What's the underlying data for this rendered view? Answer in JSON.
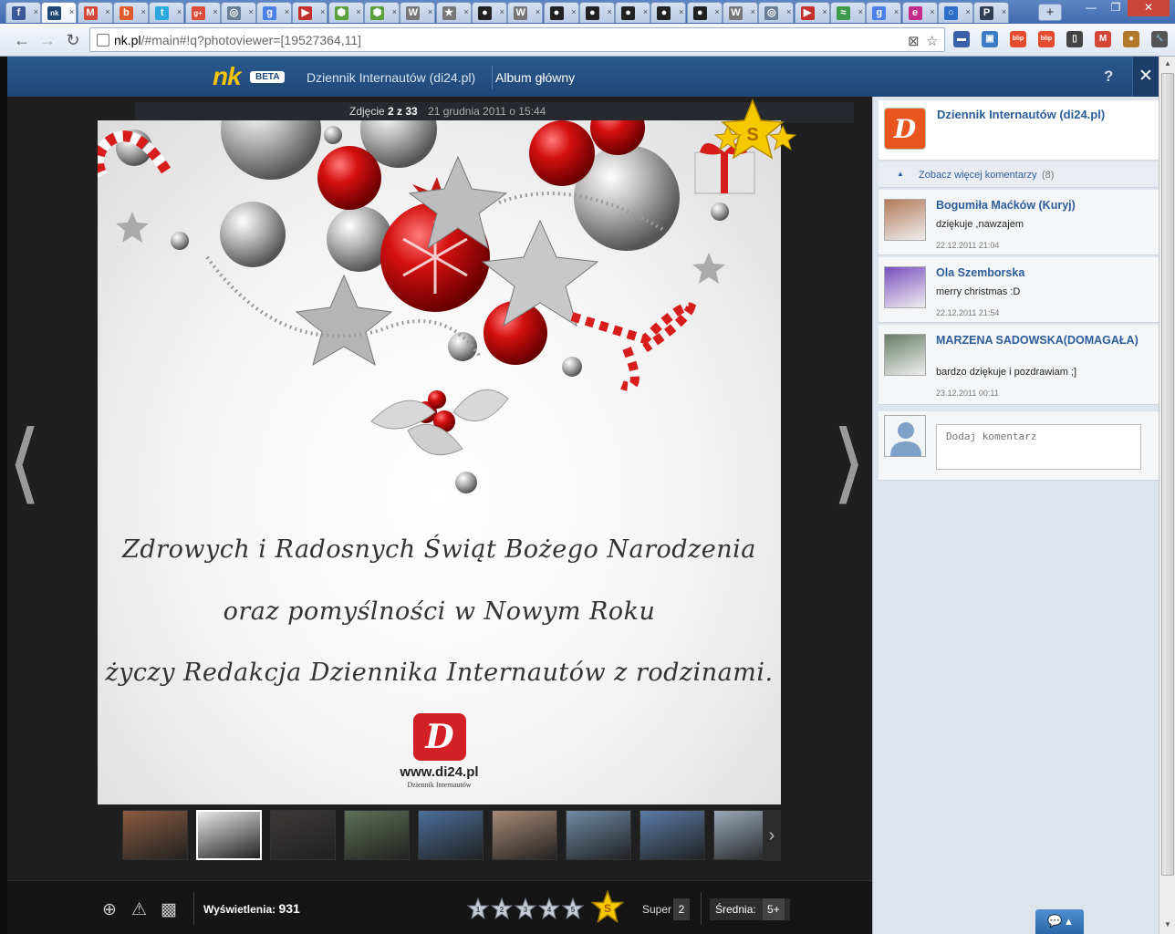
{
  "browser": {
    "tabs": [
      {
        "icon": "facebook-icon",
        "color": "#3b5998",
        "glyph": "f"
      },
      {
        "icon": "nk-icon",
        "color": "#1e4776",
        "glyph": "nk",
        "active": true
      },
      {
        "icon": "gmail-icon",
        "color": "#d44638",
        "glyph": "M"
      },
      {
        "icon": "blog-icon",
        "color": "#e05b2b",
        "glyph": "b"
      },
      {
        "icon": "twitter-icon",
        "color": "#2aa9e0",
        "glyph": "t"
      },
      {
        "icon": "google-plus-icon",
        "color": "#dd4b39",
        "glyph": "g+"
      },
      {
        "icon": "globe-icon",
        "color": "#6a7f99",
        "glyph": "◎"
      },
      {
        "icon": "google-icon",
        "color": "#4a80e8",
        "glyph": "g"
      },
      {
        "icon": "youtube-icon",
        "color": "#c4302b",
        "glyph": "▶"
      },
      {
        "icon": "hexagon-icon",
        "color": "#5aa03c",
        "glyph": "⬢"
      },
      {
        "icon": "hexagon-icon",
        "color": "#5aa03c",
        "glyph": "⬢"
      },
      {
        "icon": "wikipedia-icon",
        "color": "#777777",
        "glyph": "W"
      },
      {
        "icon": "star-icon",
        "color": "#777777",
        "glyph": "★"
      },
      {
        "icon": "github-icon",
        "color": "#222222",
        "glyph": "●"
      },
      {
        "icon": "wikipedia-icon",
        "color": "#777777",
        "glyph": "W"
      },
      {
        "icon": "github-icon",
        "color": "#222222",
        "glyph": "●"
      },
      {
        "icon": "github-icon",
        "color": "#222222",
        "glyph": "●"
      },
      {
        "icon": "github-icon",
        "color": "#222222",
        "glyph": "●"
      },
      {
        "icon": "github-icon",
        "color": "#222222",
        "glyph": "●"
      },
      {
        "icon": "github-icon",
        "color": "#222222",
        "glyph": "●"
      },
      {
        "icon": "wikipedia-icon",
        "color": "#777777",
        "glyph": "W"
      },
      {
        "icon": "globe-icon",
        "color": "#6a7f99",
        "glyph": "◎"
      },
      {
        "icon": "youtube-icon",
        "color": "#c4302b",
        "glyph": "▶"
      },
      {
        "icon": "chart-icon",
        "color": "#3c9a4a",
        "glyph": "≈"
      },
      {
        "icon": "google-icon",
        "color": "#4a80e8",
        "glyph": "g"
      },
      {
        "icon": "circle-icon",
        "color": "#c22c8b",
        "glyph": "e"
      },
      {
        "icon": "target-icon",
        "color": "#2d6ec9",
        "glyph": "○"
      },
      {
        "icon": "p-icon",
        "color": "#2f3e52",
        "glyph": "P"
      }
    ],
    "new_tab_label": "+",
    "window_controls": {
      "minimize": "—",
      "restore": "❐",
      "close": "✕"
    },
    "back": "←",
    "forward": "→",
    "reload": "↻",
    "url_host": "nk.pl",
    "url_path": "/#main#!q?photoviewer=[19527364,11]",
    "extensions": [
      {
        "icon": "flag-icon",
        "color": "#3a5fa8",
        "glyph": "▬"
      },
      {
        "icon": "screenshot-icon",
        "color": "#3c7cc7",
        "glyph": "▣"
      },
      {
        "icon": "blip-icon",
        "color": "#e34b2c",
        "glyph": "blip"
      },
      {
        "icon": "blip-icon",
        "color": "#e34b2c",
        "glyph": "blip"
      },
      {
        "icon": "phone-icon",
        "color": "#444444",
        "glyph": "▯"
      },
      {
        "icon": "gmail-icon",
        "color": "#d44638",
        "glyph": "M"
      },
      {
        "icon": "cookie-icon",
        "color": "#b4782d",
        "glyph": "●"
      },
      {
        "icon": "wrench-icon",
        "color": "#555555",
        "glyph": "🔧"
      }
    ]
  },
  "site": {
    "logo": "nk",
    "beta": "BETA",
    "owner_link": "Dziennik Internautów (di24.pl)",
    "album_link": "Album główny",
    "help": "?",
    "close": "✕"
  },
  "photo": {
    "counter_label": "Zdjęcie",
    "counter": "2 z 33",
    "date": "21 grudnia 2011 o 15:44",
    "greeting_lines": [
      "Zdrowych i Radosnych Świąt Bożego Narodzenia",
      "oraz pomyślności w Nowym Roku",
      "życzy Redakcja Dziennika Internautów z rodzinami."
    ],
    "logo_glyph": "D",
    "site_url": "www.di24.pl",
    "site_name": "Dziennik Internautów",
    "prev_arrow": "⟨",
    "next_arrow": "⟩",
    "badge_letter": "S"
  },
  "thumbnails": {
    "colors": [
      "#8a5a3f",
      "#e8e8e8",
      "#3c3838",
      "#5f6f55",
      "#4a6e9a",
      "#a88a76",
      "#6f8aa6",
      "#5a7ba8",
      "#9aa8b8"
    ],
    "active_index": 1,
    "next": "›"
  },
  "bottom": {
    "zoom_icon": "⊕",
    "report_icon": "⚠",
    "add_photo_icon": "▩",
    "views_label": "Wyświetlenia:",
    "views_count": "931",
    "ratings": [
      "1",
      "2",
      "3",
      "4",
      "5",
      "S"
    ],
    "super_label": "Super",
    "super_count": "2",
    "avg_label": "Średnia:",
    "avg_value": "5+"
  },
  "comments": {
    "owner_name": "Dziennik Internautów (di24.pl)",
    "owner_logo_glyph": "D",
    "more_label": "Zobacz więcej komentarzy",
    "more_count": "(8)",
    "items": [
      {
        "name": "Bogumiła Maćków (Kuryj)",
        "text": "dziękuje ,nawzajem",
        "date": "22.12.2011 21:04",
        "avatar_color": "#b47a5a"
      },
      {
        "name": "Ola Szemborska",
        "text": "merry christmas :D",
        "date": "22.12.2011 21:54",
        "avatar_color": "#7a4fc0"
      },
      {
        "name": "MARZENA SADOWSKA(DOMAGAŁA)",
        "text": "bardzo dziękuje i pozdrawiam ;]",
        "date": "23.12.2011 00:11",
        "avatar_color": "#6a7d6a"
      }
    ],
    "add_placeholder": "Dodaj komentarz"
  },
  "chat_label": "💬 ▴"
}
